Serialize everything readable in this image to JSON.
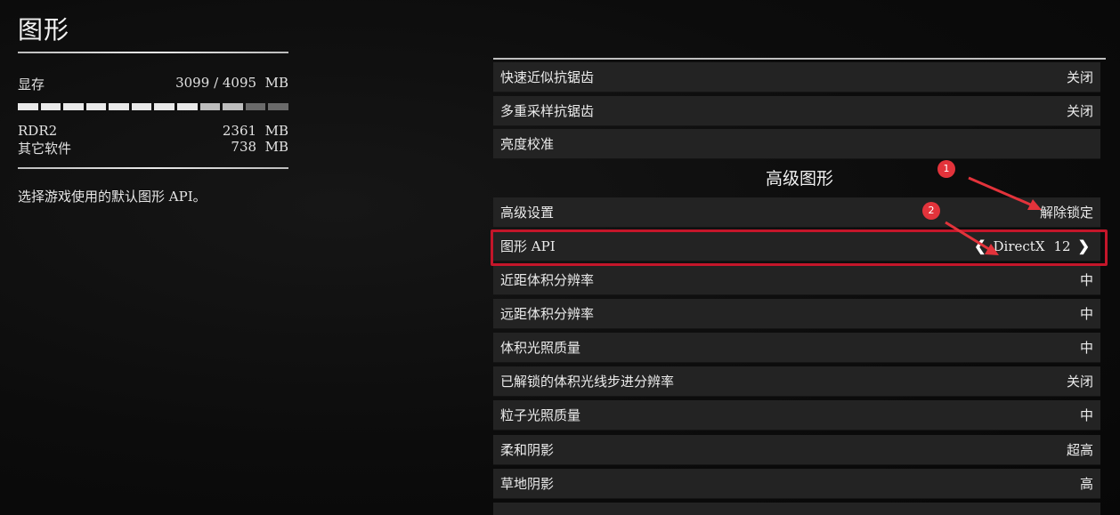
{
  "page_title": "图形",
  "vram": {
    "label": "显存",
    "used": "3099",
    "total": "/ 4095",
    "unit": "MB",
    "usage_fraction": 0.757,
    "breakdown": [
      {
        "name": "RDR2",
        "value": "2361",
        "unit": "MB"
      },
      {
        "name": "其它软件",
        "value": "738",
        "unit": "MB"
      }
    ]
  },
  "description": "选择游戏使用的默认图形 API。",
  "settings_top": [
    {
      "label": "快速近似抗锯齿",
      "value": "关闭"
    },
    {
      "label": "多重采样抗锯齿",
      "value": "关闭"
    },
    {
      "label": "亮度校准",
      "value": ""
    }
  ],
  "section_title": "高级图形",
  "advanced_settings": {
    "label": "高级设置",
    "value": "解除锁定"
  },
  "graphics_api": {
    "label": "图形 API",
    "value_name": "DirectX",
    "value_version": "12"
  },
  "settings_bottom": [
    {
      "label": "近距体积分辨率",
      "value": "中"
    },
    {
      "label": "远距体积分辨率",
      "value": "中"
    },
    {
      "label": "体积光照质量",
      "value": "中"
    },
    {
      "label": "已解锁的体积光线步进分辨率",
      "value": "关闭"
    },
    {
      "label": "粒子光照质量",
      "value": "中"
    },
    {
      "label": "柔和阴影",
      "value": "超高"
    },
    {
      "label": "草地阴影",
      "value": "高"
    }
  ],
  "annotations": [
    {
      "number": "1"
    },
    {
      "number": "2"
    }
  ],
  "colors": {
    "highlight": "#c4162a",
    "badge": "#e3333b",
    "row_bg": "#232323"
  }
}
